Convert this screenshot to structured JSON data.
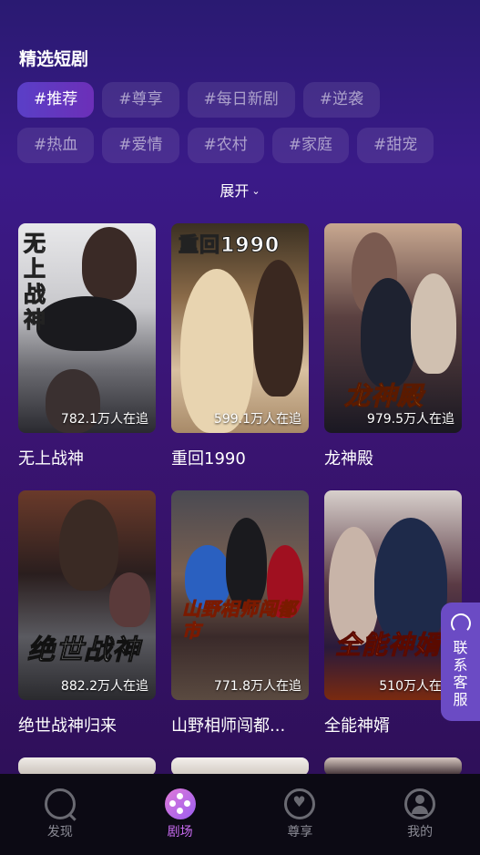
{
  "section_title": "精选短剧",
  "tags": [
    [
      "#推荐",
      "#尊享",
      "#每日新剧",
      "#逆袭"
    ],
    [
      "#热血",
      "#爱情",
      "#农村",
      "#家庭",
      "#甜宠"
    ]
  ],
  "expand_label": "展开",
  "dramas": [
    {
      "name": "无上战神",
      "followers": "782.1万人在追",
      "poster_text": "无上战神",
      "accent": "#d8d8d8"
    },
    {
      "name": "重回1990",
      "followers": "599.1万人在追",
      "poster_text": "重回1990",
      "accent": "#b8a080"
    },
    {
      "name": "龙神殿",
      "followers": "979.5万人在追",
      "poster_text": "龙神殿",
      "accent": "#f0a020"
    },
    {
      "name": "绝世战神归来",
      "followers": "882.2万人在追",
      "poster_text": "绝世战神",
      "accent": "#8a8a8a"
    },
    {
      "name": "山野相师闯都...",
      "followers": "771.8万人在追",
      "poster_text": "山野相师闯都市",
      "accent": "#f0d040"
    },
    {
      "name": "全能神婿",
      "followers": "510万人在追",
      "poster_text": "全能神婿",
      "accent": "#f04020"
    }
  ],
  "service_label": "联系客服",
  "nav": [
    {
      "label": "发现",
      "icon": "discover-icon"
    },
    {
      "label": "剧场",
      "icon": "theater-icon"
    },
    {
      "label": "尊享",
      "icon": "vip-heart-icon"
    },
    {
      "label": "我的",
      "icon": "profile-icon"
    }
  ],
  "colors": {
    "accent": "#c86bf0",
    "tag_active": "#5a3fc7",
    "nav_bg": "#0c0a14"
  }
}
